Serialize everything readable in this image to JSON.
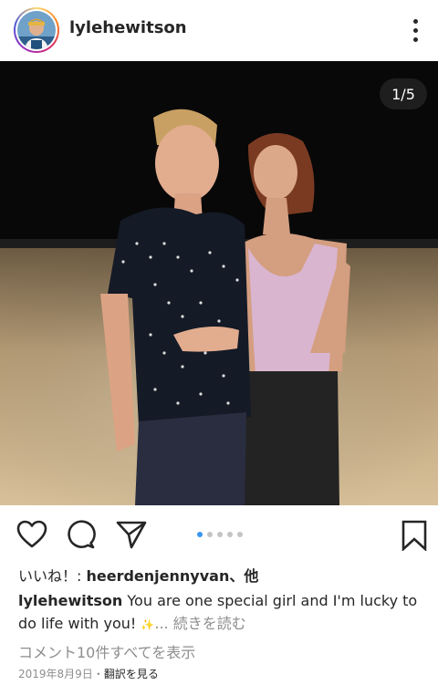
{
  "post": {
    "username": "lylehewitson",
    "image_counter": "1/5",
    "carousel": {
      "count": 5,
      "active": 1
    },
    "likes": {
      "prefix": "いいね！: ",
      "name": "heerdenjennyvan",
      "suffix": "、他"
    },
    "caption": {
      "username": "lylehewitson",
      "text": "You are one special girl and I'm lucky to do life with you!",
      "emoji": "✨",
      "ellipsis": "...",
      "more_label": "続きを読む"
    },
    "comments_link": "コメント10件すべてを表示",
    "date": "2019年8月9日",
    "separator": "・",
    "translate_label": "翻訳を見る"
  },
  "colors": {
    "accent": "#3897f0",
    "text": "#262626",
    "muted": "#8e8e8e"
  },
  "icons": [
    "more-options-icon",
    "heart-icon",
    "comment-icon",
    "share-icon",
    "bookmark-icon"
  ]
}
